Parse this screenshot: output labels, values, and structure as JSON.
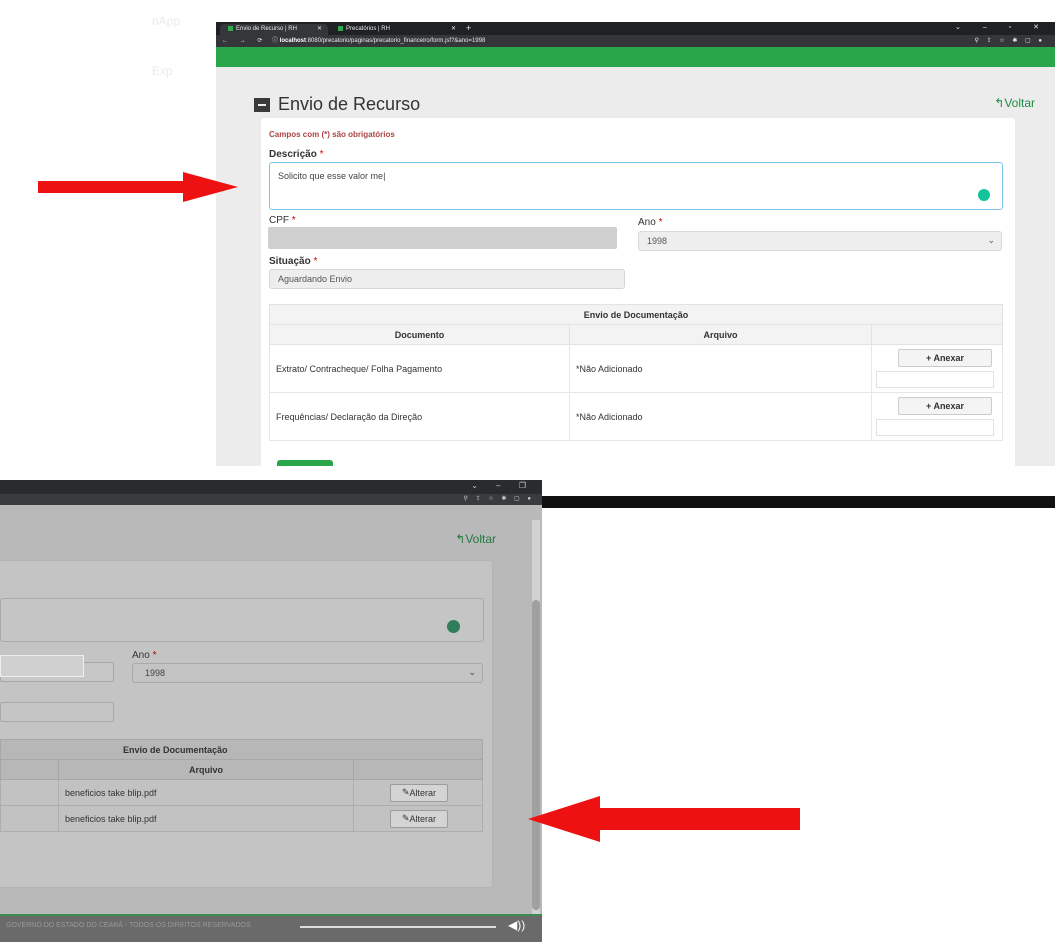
{
  "top_screenshot": {
    "browser": {
      "tabs": [
        {
          "label": "Envio de Recurso | RH",
          "active": true
        },
        {
          "label": "Precatórios | RH",
          "active": false
        }
      ],
      "url_host": "localhost",
      "url_rest": ":8080/precatorio/paginas/precatorio_financeiro/form.jsf?&ano=1998"
    },
    "page_title": "Envio de Recurso",
    "back_link": "Voltar",
    "required_note": "Campos com (*) são obrigatórios",
    "fields": {
      "descricao_label": "Descrição",
      "descricao_value": "Solicito que esse valor me",
      "cpf_label": "CPF",
      "ano_label": "Ano",
      "ano_value": "1998",
      "situacao_label": "Situação",
      "situacao_value": "Aguardando Envio",
      "required_mark": "*"
    },
    "table": {
      "title": "Envio de Documentação",
      "headers": [
        "Documento",
        "Arquivo"
      ],
      "rows": [
        {
          "documento": "Extrato/ Contracheque/ Folha Pagamento",
          "arquivo": "*Não Adicionado",
          "action": "+ Anexar"
        },
        {
          "documento": "Frequências/ Declaração da Direção",
          "arquivo": "*Não Adicionado",
          "action": "+ Anexar"
        }
      ]
    }
  },
  "bottom_screenshot": {
    "back_link": "Voltar",
    "ano_label": "Ano",
    "ano_value": "1998",
    "table": {
      "title": "Envio de Documentação",
      "header_arquivo": "Arquivo",
      "rows": [
        {
          "arquivo": "beneficios take blip.pdf",
          "action": "Alterar"
        },
        {
          "arquivo": "beneficios take blip.pdf",
          "action": "Alterar"
        }
      ]
    },
    "footer": "GOVERNO DO ESTADO DO CEARÁ - TODOS OS DIREITOS RESERVADOS"
  },
  "annotations": {
    "arrow_color": "#ee1111"
  }
}
